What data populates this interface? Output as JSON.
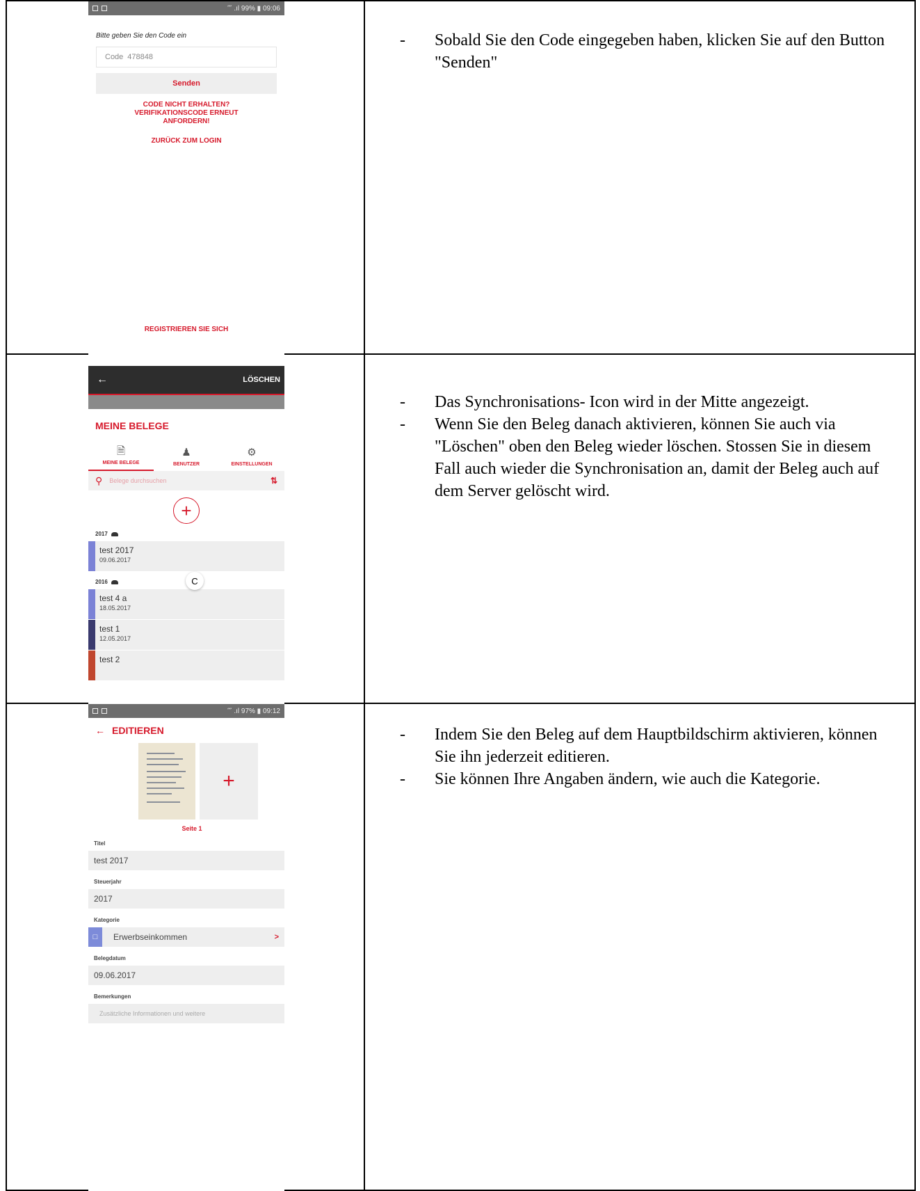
{
  "screen1": {
    "status_right": "⁗ .ıl 99% ▮ 09:06",
    "prompt": "Bitte geben Sie den Code ein",
    "code_label": "Code",
    "code_value": "478848",
    "send_button": "Senden",
    "resend_line1": "CODE NICHT ERHALTEN?",
    "resend_line2": "VERIFIKATIONSCODE ERNEUT",
    "resend_line3": "ANFORDERN!",
    "back_link": "ZURÜCK ZUM LOGIN",
    "register_link": "REGISTRIEREN SIE SICH"
  },
  "screen2": {
    "delete_button": "LÖSCHEN",
    "title": "MEINE BELEGE",
    "tabs": [
      {
        "label": "MEINE BELEGE",
        "icon": "document-icon"
      },
      {
        "label": "BENUTZER",
        "icon": "users-icon"
      },
      {
        "label": "EINSTELLUNGEN",
        "icon": "gear-icon"
      }
    ],
    "search_placeholder": "Belege durchsuchen",
    "sync_letter": "C",
    "groups": [
      {
        "year": "2017",
        "items": [
          {
            "name": "test 2017",
            "date": "09.06.2017",
            "color": "#7b82d6"
          }
        ]
      },
      {
        "year": "2016",
        "items": [
          {
            "name": "test 4 a",
            "date": "18.05.2017",
            "color": "#7b82d6"
          },
          {
            "name": "test 1",
            "date": "12.05.2017",
            "color": "#3a3a6e"
          },
          {
            "name": "test 2",
            "date": "",
            "color": "#c0462e"
          }
        ]
      }
    ]
  },
  "screen3": {
    "status_right": "⁗ .ıl 97% ▮ 09:12",
    "title": "EDITIEREN",
    "page_label": "Seite 1",
    "fields": {
      "title_label": "Titel",
      "title_value": "test 2017",
      "year_label": "Steuerjahr",
      "year_value": "2017",
      "category_label": "Kategorie",
      "category_value": "Erwerbseinkommen",
      "date_label": "Belegdatum",
      "date_value": "09.06.2017",
      "remarks_label": "Bemerkungen",
      "remarks_placeholder": "Zusätzliche Informationen und weitere"
    }
  },
  "notes": {
    "row1": [
      "Sobald Sie den Code eingegeben haben, klicken Sie auf den Button \"Senden\""
    ],
    "row2": [
      "Das Synchronisations- Icon wird in der Mitte angezeigt.",
      "Wenn Sie den Beleg danach aktivieren, können Sie auch via \"Löschen\" oben den Beleg wieder löschen. Stossen Sie in diesem Fall auch wieder die Synchronisation an, damit der Beleg auch auf dem Server gelöscht wird."
    ],
    "row3": [
      "Indem Sie den Beleg auf dem Hauptbildschirm aktivieren, können Sie ihn jederzeit editieren.",
      "Sie können Ihre Angaben ändern, wie auch die Kategorie."
    ],
    "dash": "-"
  },
  "colors": {
    "accent": "#d6192b",
    "toolbar": "#2d2d2d"
  }
}
